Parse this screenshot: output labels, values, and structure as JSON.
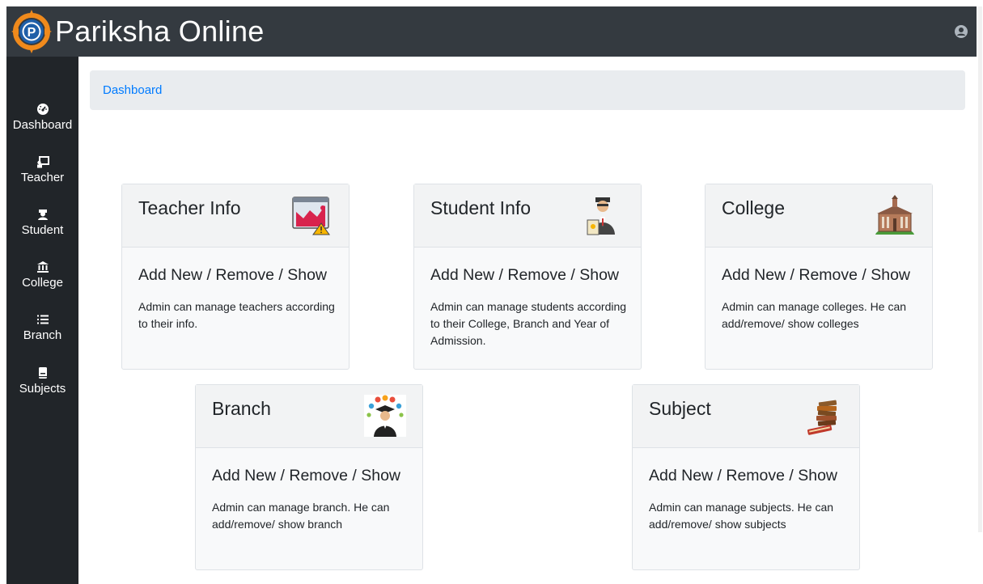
{
  "app": {
    "title": "Pariksha Online",
    "logo_letter": "P"
  },
  "sidebar": {
    "items": [
      {
        "label": "Dashboard",
        "icon": "dashboard-gauge-icon"
      },
      {
        "label": "Teacher",
        "icon": "teacher-board-icon"
      },
      {
        "label": "Student",
        "icon": "student-icon"
      },
      {
        "label": "College",
        "icon": "college-building-icon"
      },
      {
        "label": "Branch",
        "icon": "list-icon"
      },
      {
        "label": "Subjects",
        "icon": "book-icon"
      }
    ]
  },
  "breadcrumb": {
    "label": "Dashboard"
  },
  "cards": [
    {
      "title": "Teacher Info",
      "subtitle": "Add New / Remove / Show",
      "text": "Admin can manage teachers according to their info.",
      "icon": "teacher-chart-icon"
    },
    {
      "title": "Student Info",
      "subtitle": "Add New / Remove / Show",
      "text": "Admin can manage students according to their College, Branch and Year of Admission.",
      "icon": "student-person-icon"
    },
    {
      "title": "College",
      "subtitle": "Add New / Remove / Show",
      "text": "Admin can manage colleges. He can add/remove/ show colleges",
      "icon": "college-building-icon"
    },
    {
      "title": "Branch",
      "subtitle": "Add New / Remove / Show",
      "text": "Admin can manage branch. He can add/remove/ show branch",
      "icon": "graduate-icon"
    },
    {
      "title": "Subject",
      "subtitle": "Add New / Remove / Show",
      "text": "Admin can manage subjects. He can add/remove/ show subjects",
      "icon": "books-stack-icon"
    }
  ],
  "colors": {
    "topbar": "#343a40",
    "sidebar": "#212529",
    "link": "#007bff",
    "logo_orange": "#f08a1c",
    "logo_blue": "#1f5fa8"
  }
}
